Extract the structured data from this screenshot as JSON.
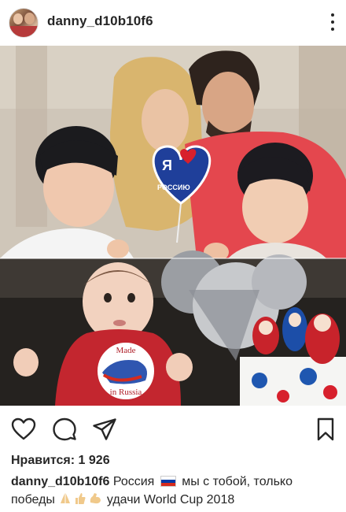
{
  "post": {
    "username": "danny_d10b10f6",
    "photo_alt": "Family photo collage",
    "sticker_lines": [
      "Made",
      "in Russia"
    ],
    "balloon_text": [
      "Я",
      "РОССИЮ"
    ],
    "likes_label": "Нравится:",
    "likes_count": "1 926",
    "caption_user": "danny_d10b10f6",
    "caption_part1": "Россия",
    "caption_part2": "мы с тобой, только победы",
    "caption_part3": "удачи World Cup 2018"
  },
  "icons": {
    "like": "heart-outline-icon",
    "comment": "comment-bubble-icon",
    "share": "paper-plane-icon",
    "save": "bookmark-icon",
    "more": "more-dots-icon"
  },
  "colors": {
    "text": "#262626",
    "flag_white": "#ffffff",
    "flag_blue": "#0039a6",
    "flag_red": "#d52b1e"
  }
}
